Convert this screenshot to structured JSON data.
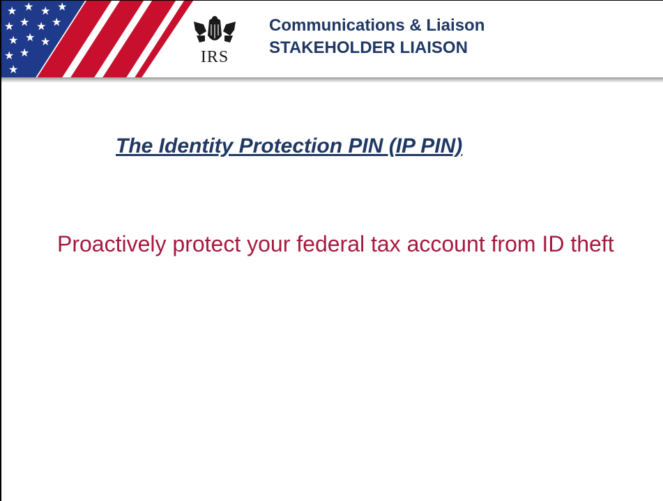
{
  "header": {
    "logo_text": "IRS",
    "line1": "Communications & Liaison",
    "line2": "STAKEHOLDER LIAISON"
  },
  "slide": {
    "title": "The Identity Protection PIN (IP PIN)",
    "body": "Proactively protect your federal tax account from ID theft"
  },
  "colors": {
    "header_text": "#1f3864",
    "title_text": "#1f3864",
    "body_text": "#a6193f",
    "flag_red": "#c8102e",
    "flag_blue": "#1f3a8a"
  },
  "icons": {
    "flag": "american-flag-graphic",
    "logo": "irs-eagle-logo"
  }
}
